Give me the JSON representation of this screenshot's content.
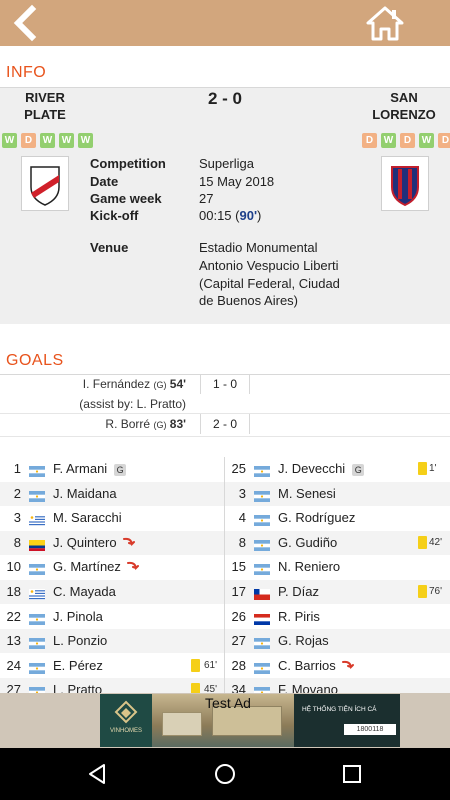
{
  "info": {
    "section_title": "INFO",
    "home_team": {
      "line1": "RIVER",
      "line2": "PLATE",
      "form": [
        "W",
        "D",
        "W",
        "W",
        "W"
      ]
    },
    "away_team": {
      "line1": "SAN",
      "line2": "LORENZO",
      "form": [
        "D",
        "W",
        "D",
        "W",
        "D"
      ]
    },
    "score": "2 - 0",
    "labels": {
      "competition": "Competition",
      "date": "Date",
      "game_week": "Game week",
      "kickoff": "Kick-off",
      "venue": "Venue"
    },
    "values": {
      "competition": "Superliga",
      "date": "15 May 2018",
      "game_week": "27",
      "kickoff_time": "00:15 (",
      "kickoff_minutes": "90'",
      "kickoff_close": ")",
      "venue_lines": [
        "Estadio Monumental",
        "Antonio Vespucio Liberti",
        "(Capital Federal, Ciudad",
        "de Buenos Aires)"
      ]
    }
  },
  "goals": {
    "section_title": "GOALS",
    "items": [
      {
        "scorer": "I. Fernández",
        "badge": "(G)",
        "minute": "54'",
        "score": "1 - 0",
        "assist": "(assist by: L. Pratto)"
      },
      {
        "scorer": "R. Borré",
        "badge": "(G)",
        "minute": "83'",
        "score": "2 - 0"
      }
    ]
  },
  "lineups": {
    "home": [
      {
        "num": "1",
        "name": "F. Armani",
        "flag": "AR",
        "keeper": "G"
      },
      {
        "num": "2",
        "name": "J. Maidana",
        "flag": "AR"
      },
      {
        "num": "3",
        "name": "M. Saracchi",
        "flag": "UY"
      },
      {
        "num": "8",
        "name": "J. Quintero",
        "flag": "CO",
        "sub": true
      },
      {
        "num": "10",
        "name": "G. Martínez",
        "flag": "AR",
        "sub": true
      },
      {
        "num": "18",
        "name": "C. Mayada",
        "flag": "UY"
      },
      {
        "num": "22",
        "name": "J. Pinola",
        "flag": "AR"
      },
      {
        "num": "13",
        "name": "L. Ponzio",
        "flag": "AR"
      },
      {
        "num": "24",
        "name": "E. Pérez",
        "flag": "AR",
        "card": "61'"
      },
      {
        "num": "27",
        "name": "L. Pratto",
        "flag": "AR",
        "card": "45'"
      }
    ],
    "away": [
      {
        "num": "25",
        "name": "J. Devecchi",
        "flag": "AR",
        "keeper": "G",
        "card": "1'"
      },
      {
        "num": "3",
        "name": "M. Senesi",
        "flag": "AR"
      },
      {
        "num": "4",
        "name": "G. Rodríguez",
        "flag": "AR"
      },
      {
        "num": "8",
        "name": "G. Gudiño",
        "flag": "AR",
        "card": "42'"
      },
      {
        "num": "15",
        "name": "N. Reniero",
        "flag": "AR"
      },
      {
        "num": "17",
        "name": "P. Díaz",
        "flag": "CL",
        "card": "76'"
      },
      {
        "num": "26",
        "name": "R. Piris",
        "flag": "PY"
      },
      {
        "num": "27",
        "name": "G. Rojas",
        "flag": "AR"
      },
      {
        "num": "28",
        "name": "C. Barrios",
        "flag": "AR",
        "sub": true
      },
      {
        "num": "34",
        "name": "F. Movano",
        "flag": "AR"
      }
    ]
  },
  "ad": {
    "label": "Test Ad",
    "brand": "VINHOMES",
    "text": "HỆ THỐNG TIỆN ÍCH CÁ",
    "phone": "1800118"
  },
  "colors": {
    "topbar": "#d2a67d",
    "section_title": "#e8531c",
    "form_win": "#93cf6f",
    "form_draw": "#f2b184",
    "yellow_card": "#f5cf18"
  },
  "icons": {
    "back": "back-arrow-icon",
    "home": "home-icon",
    "nav_back": "nav-back-icon",
    "nav_home": "nav-home-icon",
    "nav_recents": "nav-recents-icon"
  }
}
